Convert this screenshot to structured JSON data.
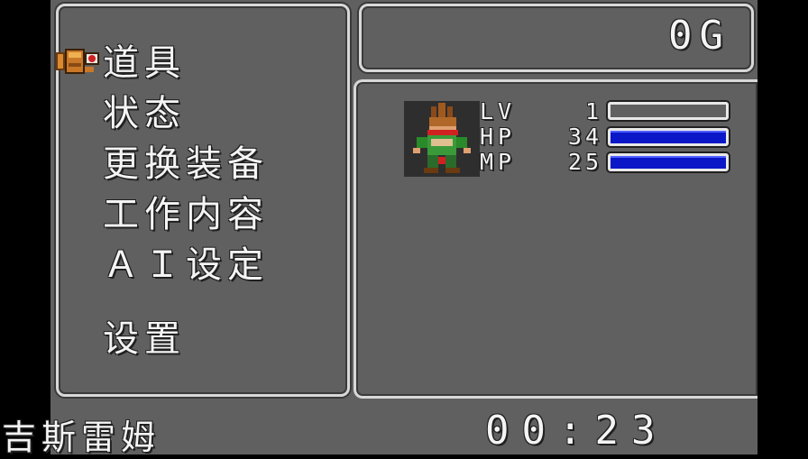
{
  "menu": {
    "items": [
      {
        "label": "道具"
      },
      {
        "label": "状态"
      },
      {
        "label": "更换装备"
      },
      {
        "label": "工作内容"
      },
      {
        "label": "ＡＩ设定"
      },
      {
        "label": "设置"
      }
    ],
    "cursor_icon": "pointing-gauntlet-icon"
  },
  "gold": {
    "value": "0G"
  },
  "party": {
    "member": {
      "portrait_icon": "hero-portrait-icon",
      "lv_label": "LV",
      "lv_value": "1",
      "hp_label": "HP",
      "hp_value": "34",
      "mp_label": "MP",
      "mp_value": "25",
      "exp_fraction": 0.0,
      "hp_fraction": 1.0,
      "mp_fraction": 1.0
    }
  },
  "footer": {
    "character_name": "吉斯雷姆",
    "play_time": "00:23"
  },
  "colors": {
    "panel_bg": "#606060",
    "border": "#d8d8d8",
    "bar_fill": "#0a18c8"
  }
}
